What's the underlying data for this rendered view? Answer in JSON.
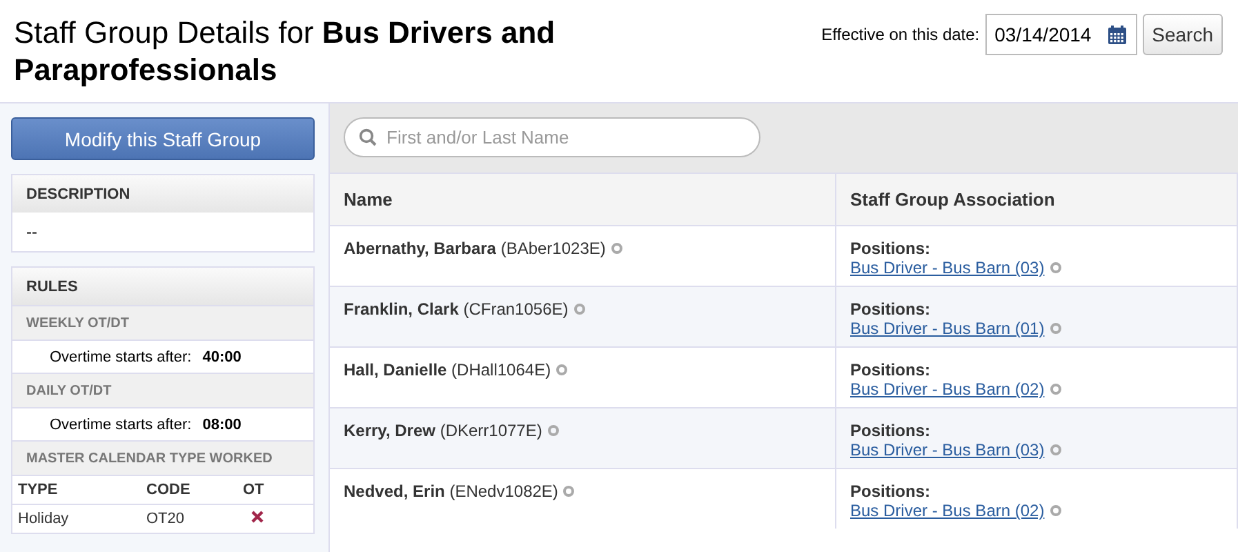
{
  "title": {
    "prefix": "Staff Group Details for",
    "group": "Bus Drivers and Paraprofessionals"
  },
  "date_filter": {
    "label": "Effective on this date:",
    "value": "03/14/2014",
    "button": "Search"
  },
  "sidebar": {
    "modify_button": "Modify this Staff Group",
    "description": {
      "heading": "DESCRIPTION",
      "text": "--"
    },
    "rules": {
      "heading": "RULES",
      "sections": [
        {
          "kind": "overtime",
          "heading": "WEEKLY OT/DT",
          "label": "Overtime starts after:",
          "value": "40:00"
        },
        {
          "kind": "overtime",
          "heading": "DAILY OT/DT",
          "label": "Overtime starts after:",
          "value": "08:00"
        },
        {
          "kind": "table",
          "heading": "MASTER CALENDAR TYPE WORKED",
          "columns": [
            "TYPE",
            "CODE",
            "OT"
          ],
          "rows": [
            {
              "type": "Holiday",
              "code": "OT20",
              "ot": false
            }
          ]
        }
      ]
    }
  },
  "search": {
    "placeholder": "First and/or Last Name"
  },
  "table": {
    "columns": [
      "Name",
      "Staff Group Association"
    ],
    "rows": [
      {
        "name": "Abernathy, Barbara",
        "id": "(BAber1023E)",
        "label": "Positions:",
        "position": "Bus Driver - Bus Barn (03)"
      },
      {
        "name": "Franklin, Clark",
        "id": "(CFran1056E)",
        "label": "Positions:",
        "position": "Bus Driver - Bus Barn (01)"
      },
      {
        "name": "Hall, Danielle",
        "id": "(DHall1064E)",
        "label": "Positions:",
        "position": "Bus Driver - Bus Barn (02)"
      },
      {
        "name": "Kerry, Drew",
        "id": "(DKerr1077E)",
        "label": "Positions:",
        "position": "Bus Driver - Bus Barn (03)"
      },
      {
        "name": "Nedved, Erin",
        "id": "(ENedv1082E)",
        "label": "Positions:",
        "position": "Bus Driver - Bus Barn (02)"
      }
    ]
  }
}
